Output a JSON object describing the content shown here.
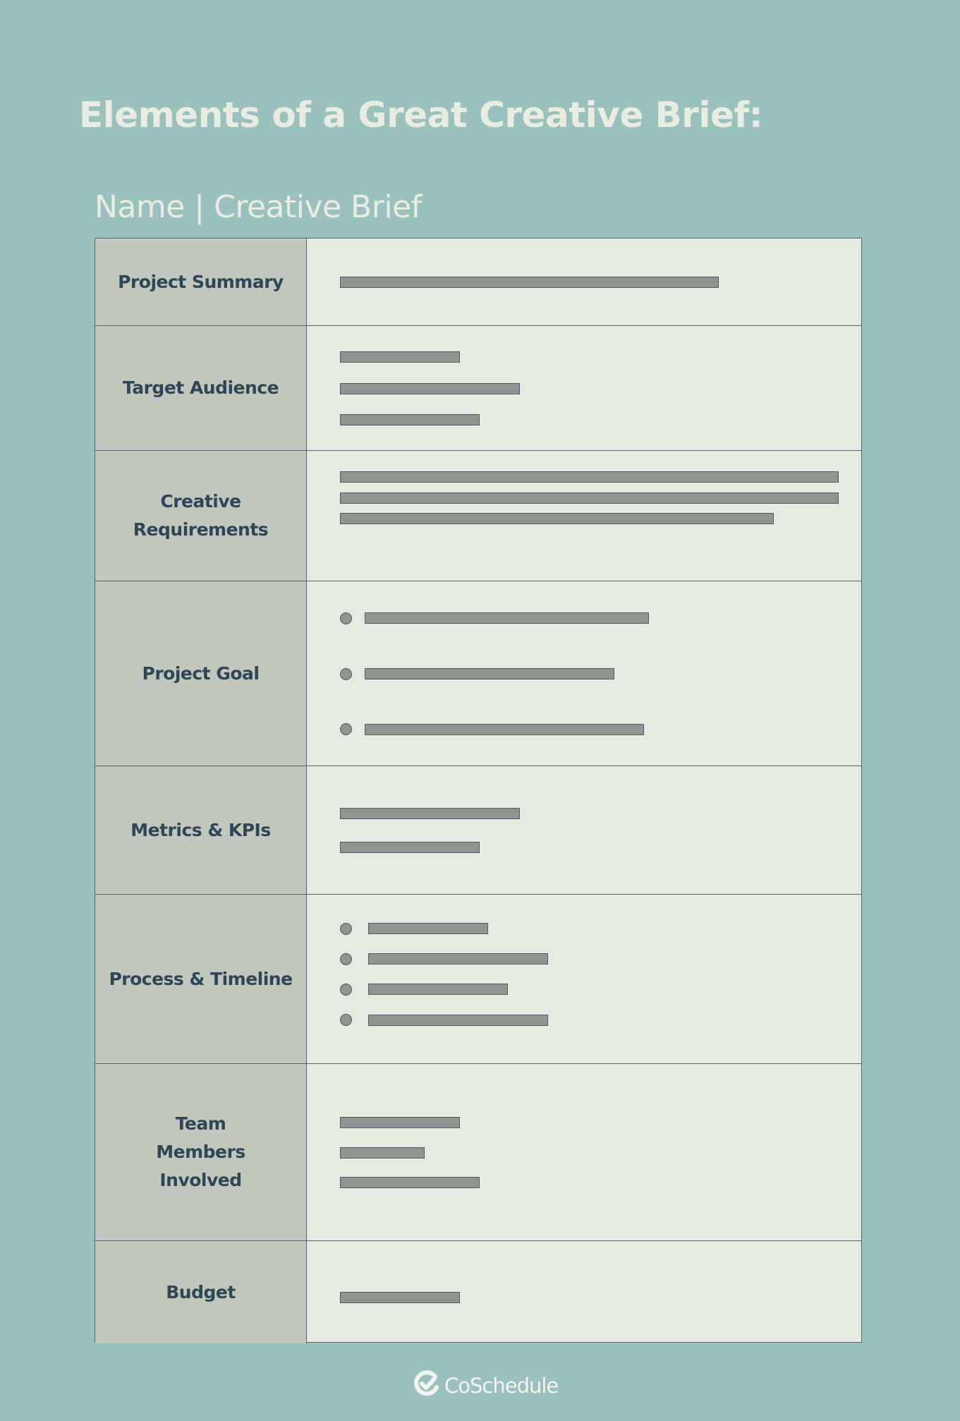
{
  "title": "Elements of a Great Creative Brief:",
  "subtitle": "Name | Creative Brief",
  "rows": [
    {
      "label": "Project Summary",
      "lines": [
        {
          "bullet": false,
          "fill": 0.76
        }
      ]
    },
    {
      "label": "Target Audience",
      "lines": [
        {
          "bullet": false,
          "fill": 0.24
        },
        {
          "bullet": false,
          "fill": 0.36
        },
        {
          "bullet": false,
          "fill": 0.28
        }
      ]
    },
    {
      "label": "Creative Requirements",
      "lines": [
        {
          "bullet": false,
          "fill": 1.0
        },
        {
          "bullet": false,
          "fill": 1.0
        },
        {
          "bullet": false,
          "fill": 0.87
        }
      ]
    },
    {
      "label": "Project Goal",
      "lines": [
        {
          "bullet": true,
          "fill": 0.57
        },
        {
          "bullet": true,
          "fill": 0.5
        },
        {
          "bullet": true,
          "fill": 0.56
        }
      ]
    },
    {
      "label": "Metrics & KPIs",
      "lines": [
        {
          "bullet": false,
          "fill": 0.36
        },
        {
          "bullet": false,
          "fill": 0.28
        }
      ]
    },
    {
      "label": "Process & Timeline",
      "lines": [
        {
          "bullet": true,
          "fill": 0.24
        },
        {
          "bullet": true,
          "fill": 0.36
        },
        {
          "bullet": true,
          "fill": 0.28
        },
        {
          "bullet": true,
          "fill": 0.36
        }
      ]
    },
    {
      "label": "Team Members Involved",
      "lines": [
        {
          "bullet": false,
          "fill": 0.24
        },
        {
          "bullet": false,
          "fill": 0.17
        },
        {
          "bullet": false,
          "fill": 0.28
        }
      ]
    },
    {
      "label": "Budget",
      "lines": [
        {
          "bullet": false,
          "fill": 0.24
        }
      ]
    }
  ],
  "footer": {
    "logo_icon": "coschedule-check-icon",
    "brand": "CoSchedule"
  },
  "colors": {
    "background": "#9ac1bd",
    "label_cell": "#c1c7bd",
    "content_cell": "#e5ebe0",
    "placeholder_bar": "#909590",
    "label_text": "#2f4656",
    "heading_text": "#e9ede1"
  }
}
